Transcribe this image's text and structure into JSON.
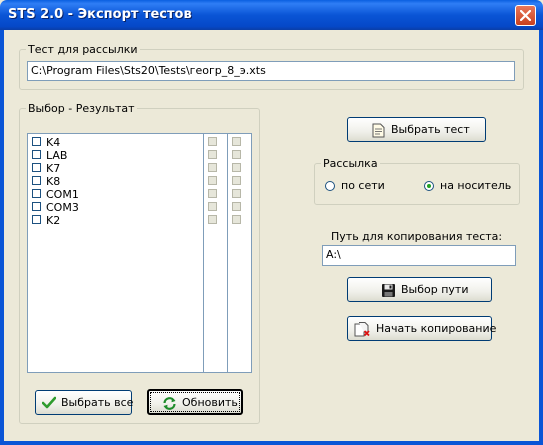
{
  "window": {
    "title": "STS 2.0 - Экспорт тестов"
  },
  "test_group": {
    "legend": "Тест для рассылки",
    "path_value": "C:\\Program Files\\Sts20\\Tests\\геогр_8_э.xts"
  },
  "select_group": {
    "legend": "Выбор - Результат",
    "items": [
      "K4",
      "LAB",
      "K7",
      "K8",
      "COM1",
      "COM3",
      "K2"
    ]
  },
  "buttons": {
    "choose_test": "Выбрать тест",
    "choose_path": "Выбор пути",
    "start_copy": "Начать копирование",
    "select_all": "Выбрать все",
    "refresh": "Обновить"
  },
  "mailing": {
    "legend": "Рассылка",
    "option_network": "по сети",
    "option_media": "на носитель",
    "selected": "на носитель"
  },
  "copy_path": {
    "label": "Путь для копирования теста:",
    "value": "A:\\"
  },
  "icons": {
    "choose_test": "document-icon",
    "choose_path": "floppy-disk-icon",
    "start_copy": "copy-start-icon",
    "select_all": "checkmark-icon",
    "refresh": "refresh-icon",
    "close": "close-icon"
  }
}
